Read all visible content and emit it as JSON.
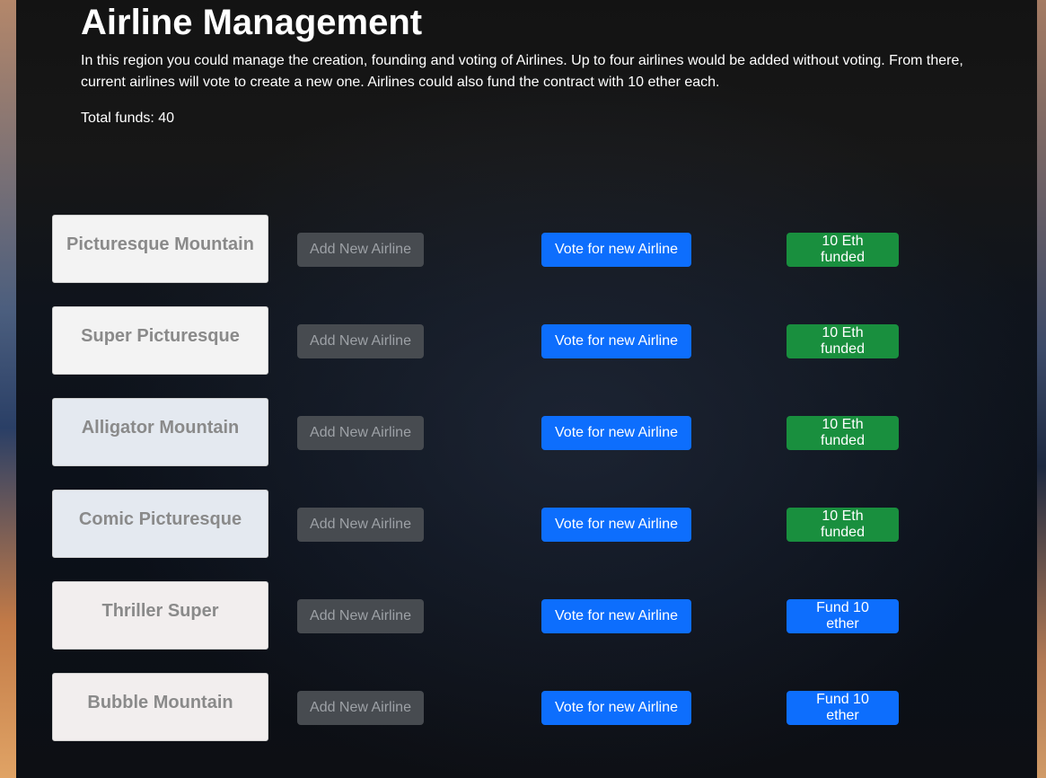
{
  "page": {
    "title": "Airline Management",
    "description": "In this region you could manage the creation, founding and voting of Airlines. Up to four airlines would be added without voting. From there, current airlines will vote to create a new one. Airlines could also fund the contract with 10 ether each.",
    "total_funds_label": "Total funds: 40"
  },
  "airlines": [
    {
      "name": "Picturesque Mountain",
      "add_label": "Add New Airline",
      "vote_label": "Vote for new Airline",
      "fund_label": "10 Eth funded",
      "funded": true
    },
    {
      "name": "Super Picturesque",
      "add_label": "Add New Airline",
      "vote_label": "Vote for new Airline",
      "fund_label": "10 Eth funded",
      "funded": true
    },
    {
      "name": "Alligator Mountain",
      "add_label": "Add New Airline",
      "vote_label": "Vote for new Airline",
      "fund_label": "10 Eth funded",
      "funded": true
    },
    {
      "name": "Comic Picturesque",
      "add_label": "Add New Airline",
      "vote_label": "Vote for new Airline",
      "fund_label": "10 Eth funded",
      "funded": true
    },
    {
      "name": "Thriller Super",
      "add_label": "Add New Airline",
      "vote_label": "Vote for new Airline",
      "fund_label": "Fund 10 ether",
      "funded": false
    },
    {
      "name": "Bubble Mountain",
      "add_label": "Add New Airline",
      "vote_label": "Vote for new Airline",
      "fund_label": "Fund 10 ether",
      "funded": false
    }
  ],
  "colors": {
    "primary": "#0d6efd",
    "success": "#198f3e",
    "disabled": "#474b50"
  }
}
